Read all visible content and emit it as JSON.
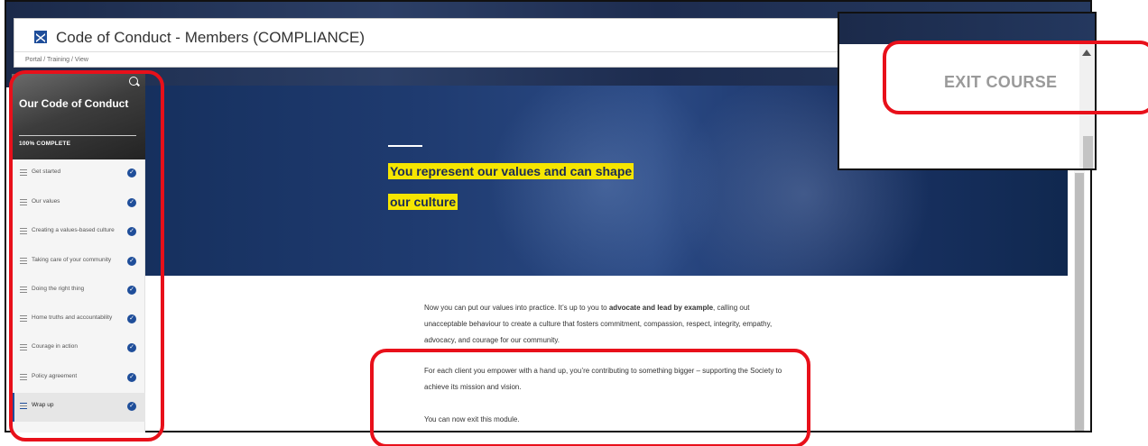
{
  "app": {
    "title": "Code of Conduct - Members (COMPLIANCE)",
    "breadcrumb": "Portal / Training / View"
  },
  "sidebar": {
    "course_title": "Our Code of Conduct",
    "progress": "100% COMPLETE",
    "items": [
      {
        "label": "Get started",
        "completed": true
      },
      {
        "label": "Our values",
        "completed": true
      },
      {
        "label": "Creating a values-based culture",
        "completed": true
      },
      {
        "label": "Taking care of your community",
        "completed": true
      },
      {
        "label": "Doing the right thing",
        "completed": true
      },
      {
        "label": "Home truths and accountability",
        "completed": true
      },
      {
        "label": "Courage in action",
        "completed": true
      },
      {
        "label": "Policy agreement",
        "completed": true
      },
      {
        "label": "Wrap up",
        "completed": true,
        "active": true
      }
    ]
  },
  "hero": {
    "heading_line1": "You represent our values and can shape",
    "heading_line2": "our culture"
  },
  "content": {
    "p1_a": "Now you can put our values into practice. It’s up to you to ",
    "p1_b": "advocate and lead by example",
    "p1_c": ", calling out unacceptable behaviour to create a culture that fosters commitment, compassion, respect, integrity, empathy, advocacy, and courage for our community.",
    "p2_a": "For each client you empower with a hand up, you’re contributing to something bigger",
    "p2_b": " – supporting the Society to achieve its mission and vision.",
    "p3": "You can now exit this module."
  },
  "exit": {
    "label": "EXIT COURSE"
  },
  "colors": {
    "accent_blue": "#1f4e9a",
    "highlight": "#f6e600",
    "annotation_red": "#e8101a"
  }
}
